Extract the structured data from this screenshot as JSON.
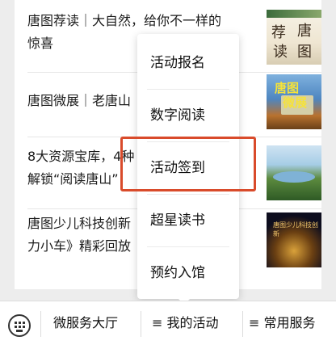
{
  "feed": {
    "items": [
      {
        "title": "唐图荐读｜大自然，给你不一样的\n惊喜",
        "thumb": "book-cover-thumbnail",
        "thumb_text": [
          "荐",
          "唐",
          "读",
          "图"
        ]
      },
      {
        "title": "唐图微展｜老唐山",
        "thumb": "library-building-thumbnail",
        "thumb_text": [
          "唐图",
          "微展"
        ]
      },
      {
        "title": "8大资源宝库，4种\n解锁“阅读唐山”",
        "thumb": "landscape-thumbnail"
      },
      {
        "title": "唐图少儿科技创新\n力小车》精彩回放",
        "thumb": "stage-event-thumbnail",
        "thumb_text": [
          "唐图少儿科技创新"
        ]
      }
    ]
  },
  "menu": {
    "items": [
      {
        "label": "活动报名"
      },
      {
        "label": "数字阅读"
      },
      {
        "label": "活动签到",
        "highlighted": true
      },
      {
        "label": "超星读书"
      },
      {
        "label": "预约入馆"
      }
    ]
  },
  "bottom_bar": {
    "keyboard_icon": "keyboard-icon",
    "buttons": [
      {
        "label": "微服务大厅"
      },
      {
        "label": "≡ 我的活动",
        "highlighted": true
      },
      {
        "label": "≡ 常用服务"
      }
    ]
  },
  "colors": {
    "highlight": "#d94b2b",
    "background": "#ededed"
  }
}
